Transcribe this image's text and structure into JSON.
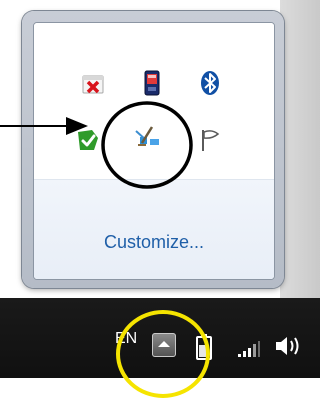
{
  "tray_popup": {
    "customize_label": "Customize...",
    "icons": [
      {
        "name": "error-x-icon"
      },
      {
        "name": "phone-device-icon"
      },
      {
        "name": "bluetooth-icon"
      },
      {
        "name": "green-check-icon"
      },
      {
        "name": "network-tool-icon"
      },
      {
        "name": "flag-icon"
      }
    ]
  },
  "taskbar": {
    "language": "EN",
    "show_hidden_icons": "up-arrow-icon",
    "status_icons": [
      "battery-icon",
      "signal-icon",
      "speaker-icon"
    ]
  },
  "colors": {
    "link": "#1f5fa8",
    "highlight_circle": "#f5e400",
    "annotation_black": "#000000",
    "taskbar": "#141414"
  }
}
